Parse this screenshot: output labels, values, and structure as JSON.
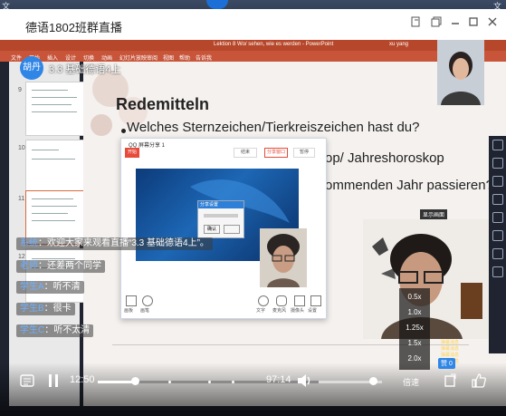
{
  "window": {
    "title": "德语1802班群直播"
  },
  "desktop_top": {
    "left_text": "文",
    "right_text": "文"
  },
  "ppt": {
    "doc_title": "Lektion 8 Wo/ sehen, wie es werden - PowerPoint",
    "tabs": [
      "文件",
      "开始",
      "插入",
      "设计",
      "切换",
      "动画",
      "幻灯片放映",
      "审阅",
      "视图",
      "帮助",
      "告诉我"
    ],
    "account": "xu yang"
  },
  "course": {
    "avatar_text": "胡丹",
    "name": "3.3 基础德语4上"
  },
  "slide": {
    "heading": "Redemitteln",
    "line1": "Welches Sternzeichen/Tierkreiszeichen hast du?",
    "line2": "op/ Jahreshoroskop",
    "line3": "ommenden Jahr passieren?",
    "thumb_numbers": [
      "9",
      "10",
      "11",
      "12"
    ]
  },
  "dialog": {
    "title": "QQ 屏幕分享 1",
    "tabs": [
      "开始",
      "结束",
      "分享窗口",
      "暂停"
    ],
    "inner_title": "分享设置",
    "inner_button": "确认",
    "toolbar": [
      "画板",
      "画笔",
      "文字",
      "麦克风",
      "摄像头",
      "设置"
    ]
  },
  "big_cam_label": "显示画面",
  "chat": [
    {
      "name": "系统",
      "text": "欢迎大家来观看直播“3.3 基础德语4上”。"
    },
    {
      "name": "老师",
      "text": "还差两个同学"
    },
    {
      "name": "学生A",
      "text": "听不清"
    },
    {
      "name": "学生B",
      "text": "很卡"
    },
    {
      "name": "学生C",
      "text": "听不太清"
    }
  ],
  "speed_options": [
    "0.5x",
    "1.0x",
    "1.25x",
    "1.5x",
    "2.0x"
  ],
  "right_comments": [
    "弹幕消息",
    "弹幕消息",
    "弹幕消息",
    "弹幕消息",
    "弹幕消息"
  ],
  "player": {
    "current_time": "12:50",
    "total_time": "97:14",
    "progress": 0.132,
    "volume": 0.86,
    "speed_label": "倍速",
    "like_label": "赞 0"
  }
}
